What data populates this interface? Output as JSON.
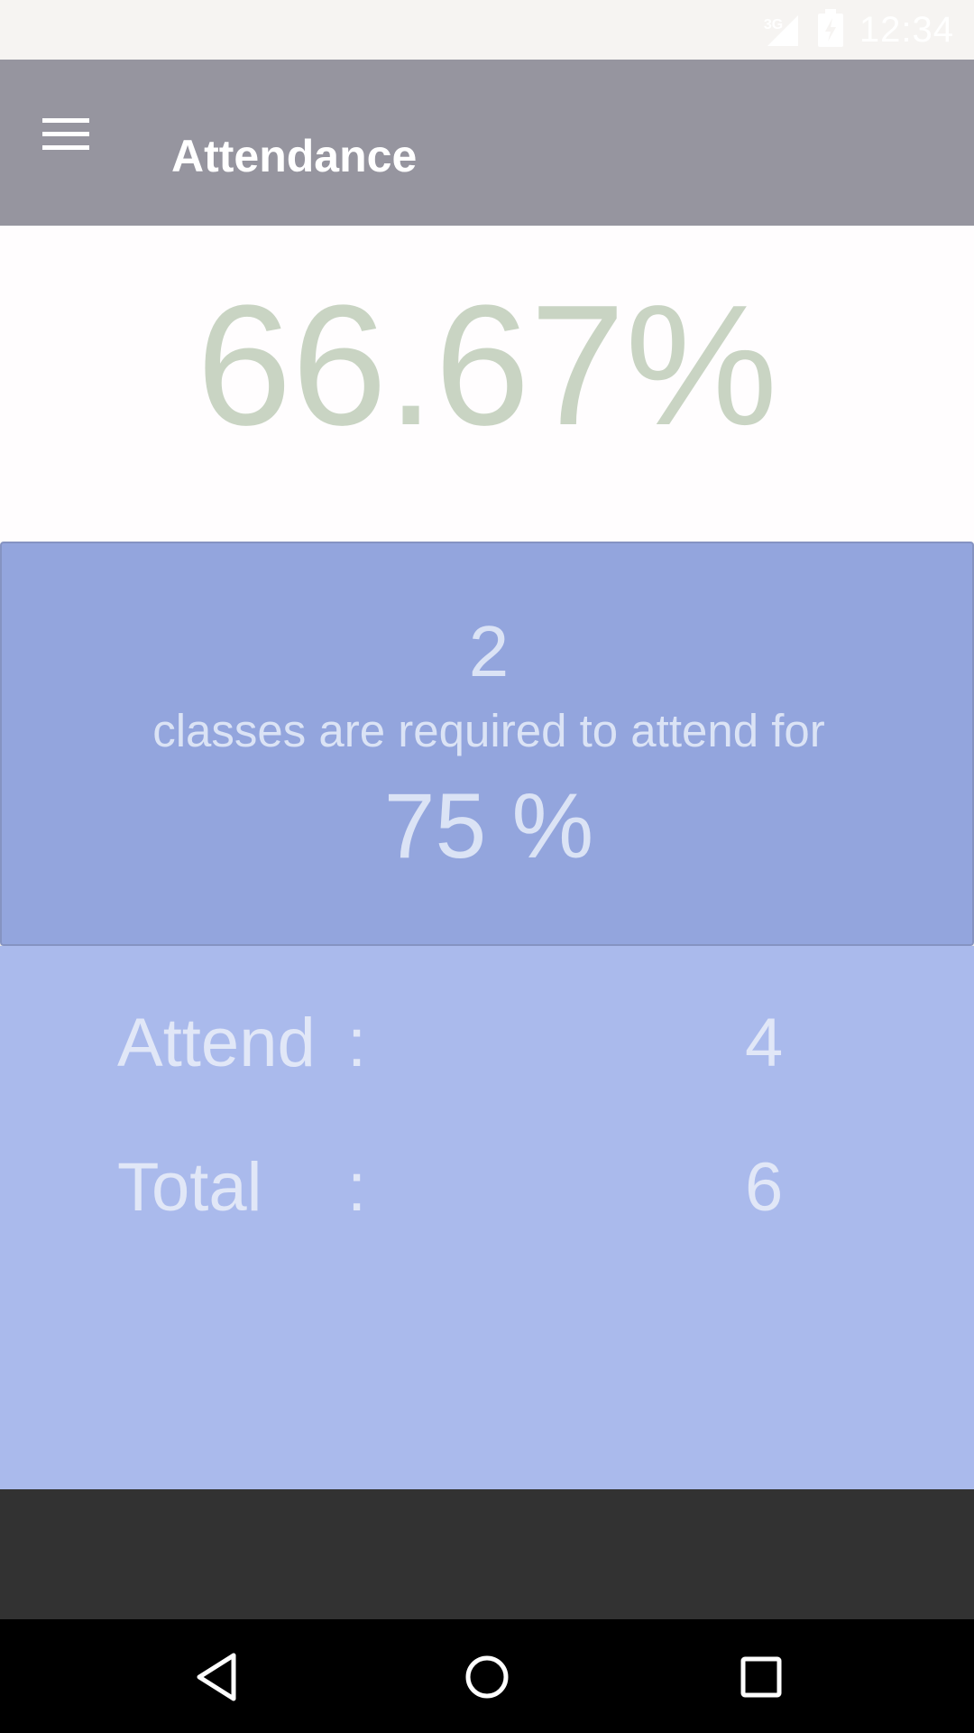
{
  "status_bar": {
    "network_type": "3G",
    "time": "12:34",
    "icons": [
      "signal-icon",
      "battery-icon"
    ]
  },
  "app_bar": {
    "menu_icon": "hamburger-menu-icon",
    "title": "Attendance"
  },
  "attendance": {
    "percentage": "66.67%"
  },
  "requirement": {
    "count": "2",
    "message": "classes are required to attend for",
    "target": "75 %"
  },
  "stats": {
    "attend_label": "Attend",
    "attend_colon": ":",
    "attend_value": "4",
    "total_label": "Total",
    "total_colon": ":",
    "total_value": "6"
  },
  "nav_bar": {
    "icons": [
      "back-icon",
      "home-icon",
      "recent-apps-icon"
    ]
  },
  "colors": {
    "app_bar": "#96959f",
    "percentage_text": "#c9d4c3",
    "requirement_card": "#93a5dd",
    "stats_background": "#aabaec",
    "dark_strip": "#323232"
  }
}
